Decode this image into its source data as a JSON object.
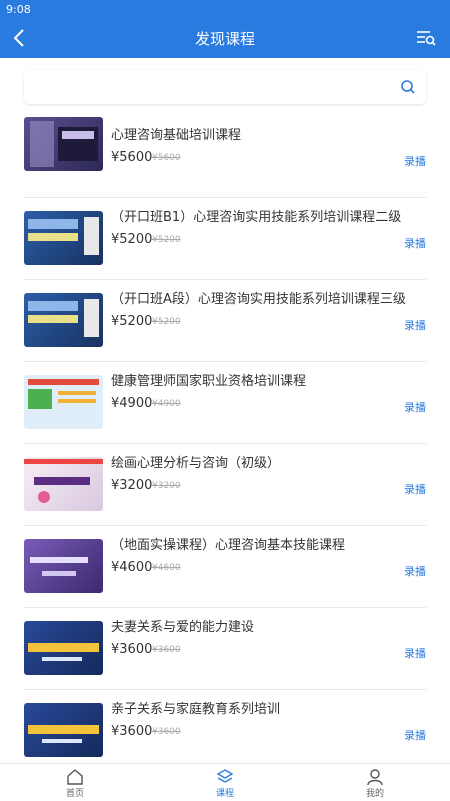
{
  "status": {
    "time": "9:08"
  },
  "header": {
    "title": "发现课程"
  },
  "search": {
    "placeholder": ""
  },
  "courses": [
    {
      "title": "心理咨询基础培训课程",
      "price": "¥5600",
      "old_price": "¥5600",
      "tag": "录播"
    },
    {
      "title": "（开口班B1）心理咨询实用技能系列培训课程二级",
      "price": "¥5200",
      "old_price": "¥5200",
      "tag": "录播"
    },
    {
      "title": "（开口班A段）心理咨询实用技能系列培训课程三级",
      "price": "¥5200",
      "old_price": "¥5200",
      "tag": "录播"
    },
    {
      "title": "健康管理师国家职业资格培训课程",
      "price": "¥4900",
      "old_price": "¥4900",
      "tag": "录播"
    },
    {
      "title": "绘画心理分析与咨询（初级）",
      "price": "¥3200",
      "old_price": "¥3200",
      "tag": "录播"
    },
    {
      "title": "（地面实操课程）心理咨询基本技能课程",
      "price": "¥4600",
      "old_price": "¥4600",
      "tag": "录播"
    },
    {
      "title": "夫妻关系与爱的能力建设",
      "price": "¥3600",
      "old_price": "¥3600",
      "tag": "录播"
    },
    {
      "title": "亲子关系与家庭教育系列培训",
      "price": "¥3600",
      "old_price": "¥3600",
      "tag": "录播"
    }
  ],
  "tabbar": {
    "home": "首页",
    "courses": "课程",
    "mine": "我的"
  },
  "colors": {
    "accent": "#2a7be0"
  },
  "icons": {
    "back": "chevron-left-icon",
    "filter": "filter-list-icon",
    "search": "search-icon",
    "home": "home-icon",
    "courses": "layers-icon",
    "mine": "user-icon"
  }
}
